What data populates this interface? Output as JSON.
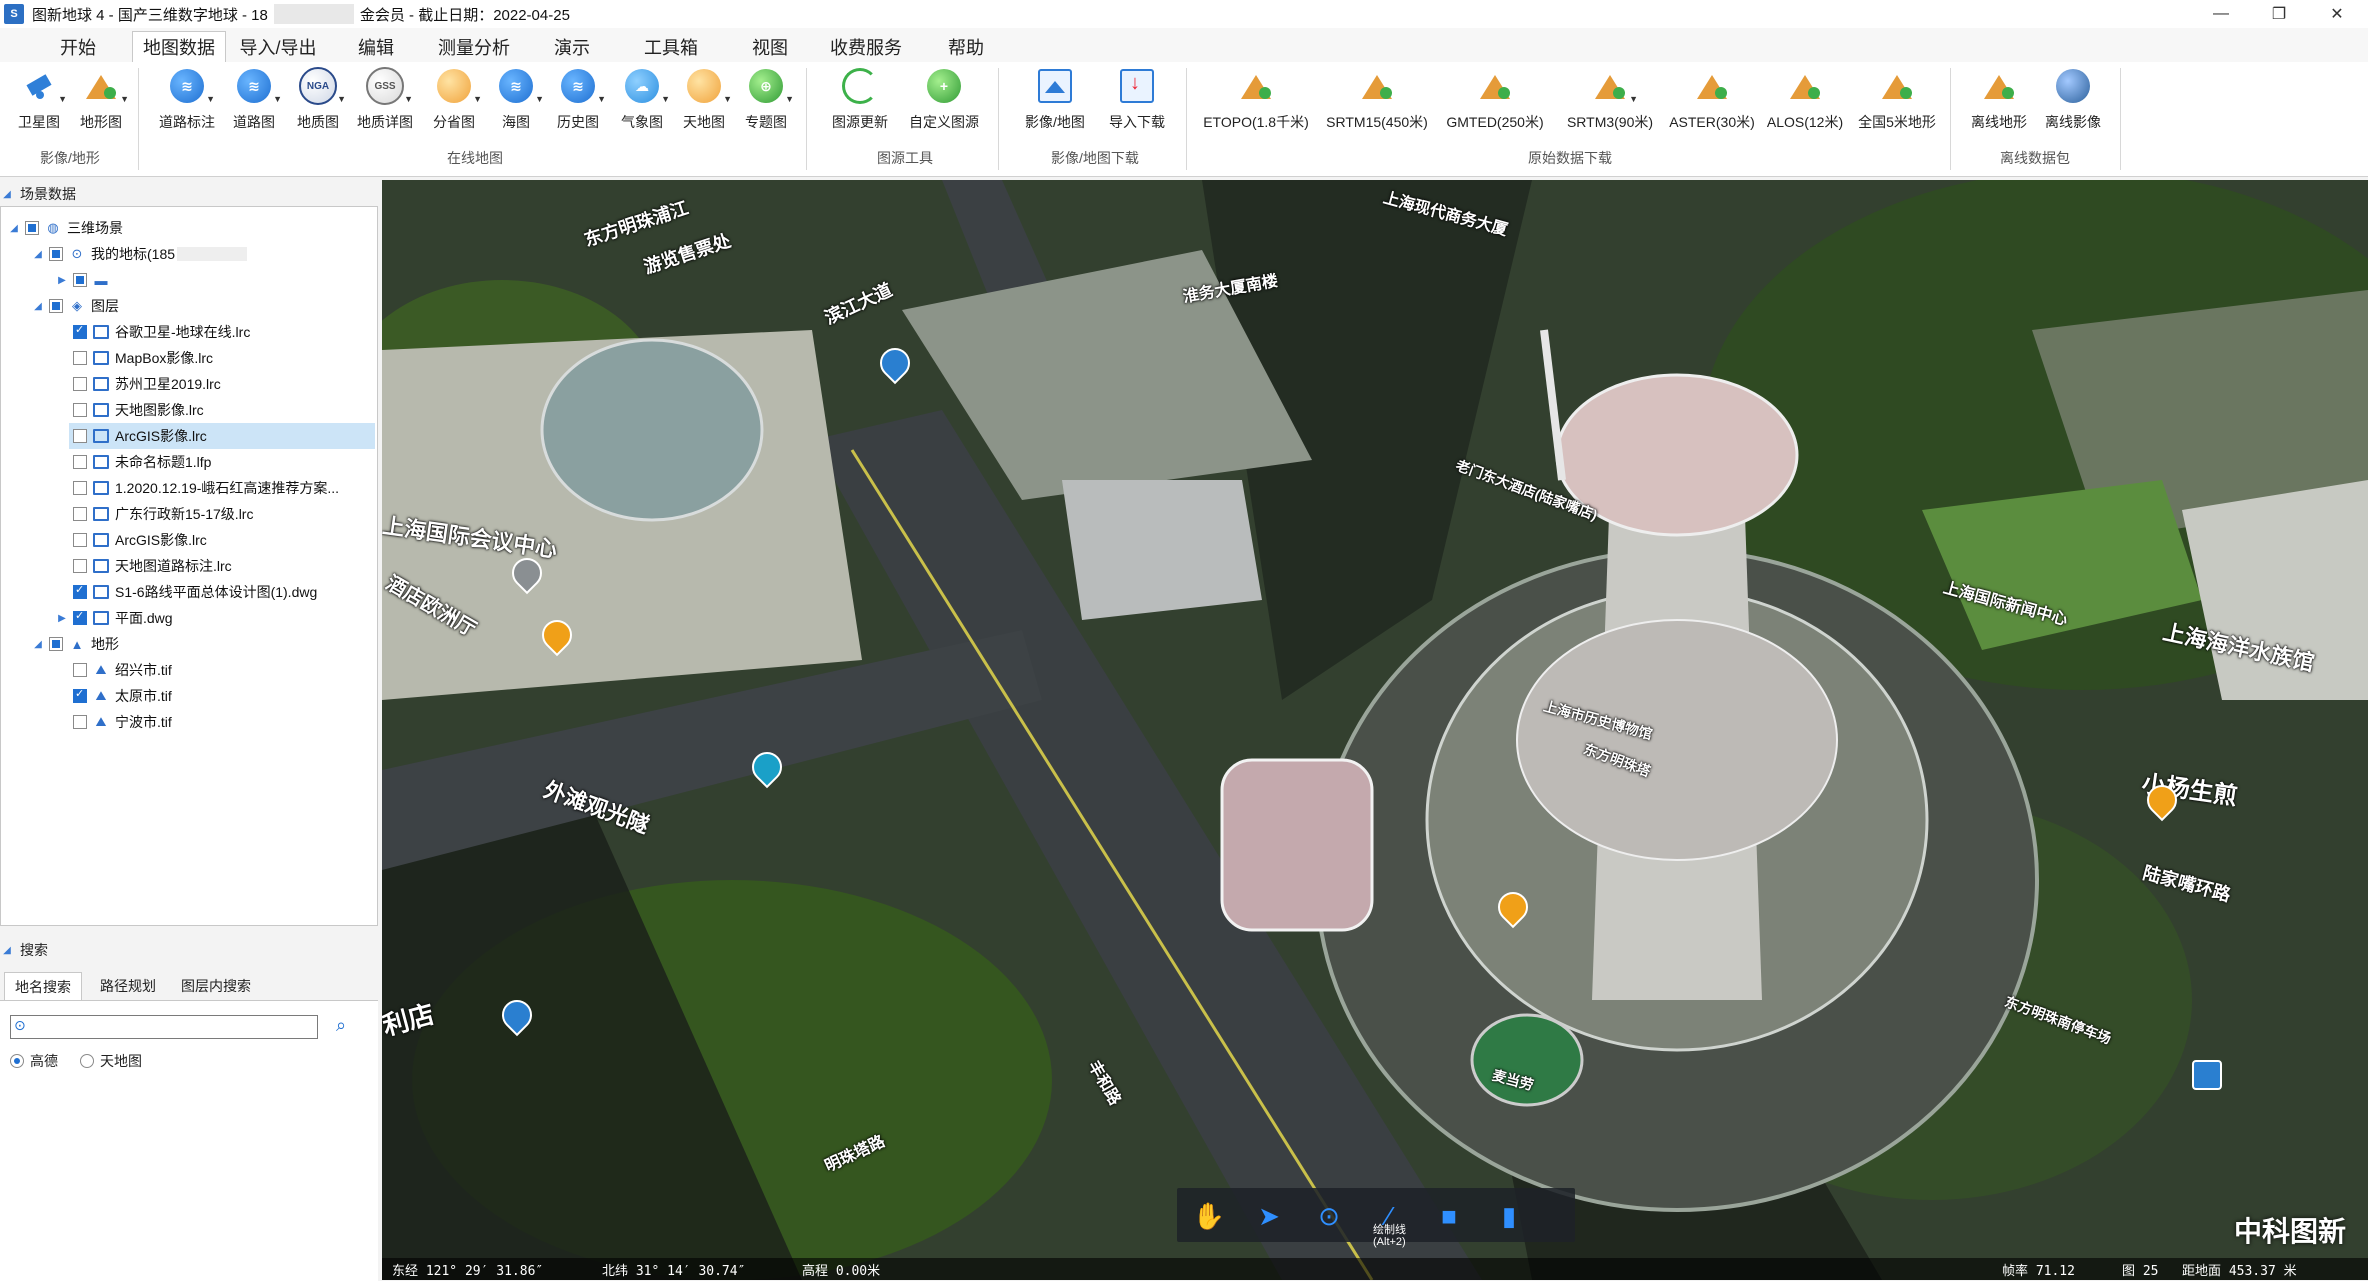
{
  "window": {
    "title": "图新地球 4 - 国产三维数字地球 - 18",
    "title_suffix": "金会员 - 截止日期：2022-04-25",
    "app_icon_text": "S"
  },
  "menu": {
    "tabs": [
      "开始",
      "地图数据",
      "导入/导出",
      "编辑",
      "测量分析",
      "演示",
      "工具箱",
      "视图",
      "收费服务",
      "帮助"
    ],
    "active": "地图数据"
  },
  "ribbon": {
    "buttons": [
      "卫星图",
      "地形图",
      "道路标注",
      "道路图",
      "地质图",
      "地质详图",
      "分省图",
      "海图",
      "历史图",
      "气象图",
      "天地图",
      "专题图",
      "图源更新",
      "自定义图源",
      "影像/地图",
      "导入下载",
      "ETOPO(1.8千米)",
      "SRTM15(450米)",
      "GMTED(250米)",
      "SRTM3(90米)",
      "ASTER(30米)",
      "ALOS(12米)",
      "全国5米地形",
      "离线地形",
      "离线影像"
    ],
    "groups": [
      "影像/地形",
      "在线地图",
      "图源工具",
      "影像/地图下载",
      "原始数据下载",
      "离线数据包"
    ],
    "icon_texts": {
      "nga": "NGA",
      "gss": "GSS"
    }
  },
  "scene_panel": {
    "header": "场景数据",
    "tree": [
      {
        "label": "三维场景",
        "checked": "partial",
        "icon": "globe-icon"
      },
      {
        "label": "我的地标(185",
        "checked": "partial",
        "icon": "pin-icon"
      },
      {
        "label": "",
        "checked": "partial",
        "icon": "folder-icon"
      },
      {
        "label": "图层",
        "checked": "partial",
        "icon": "layers-icon"
      },
      {
        "label": "谷歌卫星-地球在线.lrc",
        "checked": true,
        "icon": "layer-icon"
      },
      {
        "label": "MapBox影像.lrc",
        "checked": false,
        "icon": "layer-icon"
      },
      {
        "label": "苏州卫星2019.lrc",
        "checked": false,
        "icon": "layer-icon"
      },
      {
        "label": "天地图影像.lrc",
        "checked": false,
        "icon": "layer-icon"
      },
      {
        "label": "ArcGIS影像.lrc",
        "checked": false,
        "icon": "layer-icon",
        "selected": true
      },
      {
        "label": "未命名标题1.lfp",
        "checked": false,
        "icon": "layer-icon"
      },
      {
        "label": "1.2020.12.19-峨石红高速推荐方案...",
        "checked": false,
        "icon": "layer-icon"
      },
      {
        "label": "广东行政新15-17级.lrc",
        "checked": false,
        "icon": "layer-icon"
      },
      {
        "label": "ArcGIS影像.lrc",
        "checked": false,
        "icon": "layer-icon"
      },
      {
        "label": "天地图道路标注.lrc",
        "checked": false,
        "icon": "layer-icon"
      },
      {
        "label": "S1-6路线平面总体设计图(1).dwg",
        "checked": true,
        "icon": "layer-icon"
      },
      {
        "label": "平面.dwg",
        "checked": true,
        "icon": "layer-icon"
      },
      {
        "label": "地形",
        "checked": "partial",
        "icon": "terrain-icon"
      },
      {
        "label": "绍兴市.tif",
        "checked": false,
        "icon": "terrain-file-icon"
      },
      {
        "label": "太原市.tif",
        "checked": true,
        "icon": "terrain-file-icon"
      },
      {
        "label": "宁波市.tif",
        "checked": false,
        "icon": "terrain-file-icon"
      }
    ]
  },
  "search_panel": {
    "header": "搜索",
    "tabs": [
      "地名搜索",
      "路径规划",
      "图层内搜索"
    ],
    "active_tab": "地名搜索",
    "input_value": "",
    "radios": [
      "高德",
      "天地图"
    ],
    "selected_radio": "高德"
  },
  "map": {
    "labels": [
      "东方明珠浦江",
      "游览售票处",
      "滨江大道",
      "淮务大厦南楼",
      "上海现代商务大厦",
      "上海国际会议中心",
      "酒店欧洲厅",
      "外滩观光隧",
      "上海国际新闻中心",
      "上海海洋水族馆",
      "小杨生煎",
      "东方明珠塔",
      "明珠塔路",
      "丰和路",
      "上海市历史博物馆",
      "东方明珠南停车场",
      "陆家嘴环路",
      "老门东大酒店(陆家嘴店)",
      "利店",
      "麦当劳"
    ],
    "watermark": "中科图新",
    "tools": [
      "hand-tool",
      "pointer-tool",
      "placemark-tool",
      "draw-line-tool",
      "draw-polygon-tool",
      "chart-tool"
    ],
    "draw_tooltip": "绘制线\n(Alt+2)",
    "status": {
      "lon": "东经 121°  29′  31.86″",
      "lat": "北纬 31°  14′  30.74″",
      "elev": "高程 0.00米",
      "fps": "帧率 71.12",
      "eye": "图 25",
      "view_alt": "距地面 453.37 米"
    }
  }
}
